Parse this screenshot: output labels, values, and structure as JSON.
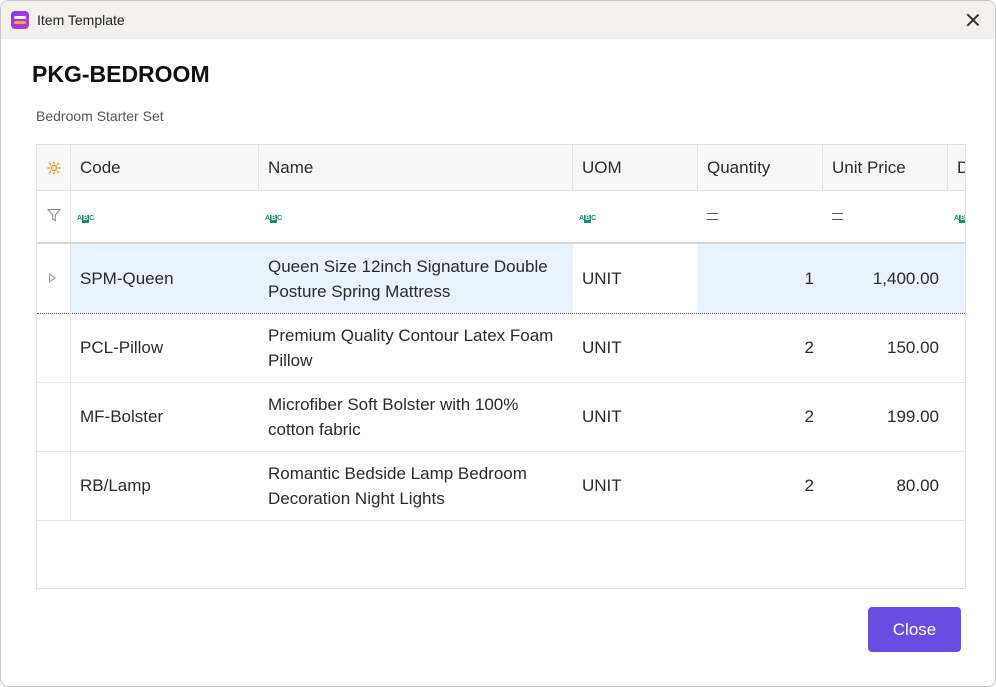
{
  "window": {
    "title": "Item Template"
  },
  "heading": "PKG-BEDROOM",
  "subheading": "Bedroom Starter Set",
  "grid": {
    "columns": [
      {
        "key": "code",
        "label": "Code",
        "filter": "text"
      },
      {
        "key": "name",
        "label": "Name",
        "filter": "text"
      },
      {
        "key": "uom",
        "label": "UOM",
        "filter": "text"
      },
      {
        "key": "quantity",
        "label": "Quantity",
        "filter": "equals"
      },
      {
        "key": "unit_price",
        "label": "Unit Price",
        "filter": "equals"
      },
      {
        "key": "d",
        "label": "D",
        "filter": "text"
      }
    ],
    "rows": [
      {
        "code": "SPM-Queen",
        "name": "Queen Size 12inch Signature Double Posture Spring Mattress",
        "uom": "UNIT",
        "quantity": "1",
        "unit_price": "1,400.00",
        "selected": true
      },
      {
        "code": "PCL-Pillow",
        "name": "Premium Quality Contour Latex Foam Pillow",
        "uom": "UNIT",
        "quantity": "2",
        "unit_price": "150.00"
      },
      {
        "code": "MF-Bolster",
        "name": "Microfiber Soft Bolster with 100% cotton fabric",
        "uom": "UNIT",
        "quantity": "2",
        "unit_price": "199.00"
      },
      {
        "code": "RB/Lamp",
        "name": "Romantic Bedside Lamp Bedroom Decoration Night Lights",
        "uom": "UNIT",
        "quantity": "2",
        "unit_price": "80.00"
      }
    ]
  },
  "footer": {
    "close_label": "Close"
  },
  "colors": {
    "accent": "#6b4be2",
    "selection": "#e8f3fd",
    "filter_icon": "#1a8a72",
    "settings_icon": "#f08a1a"
  },
  "icons": {
    "settings": "gear-icon",
    "filter": "filter-icon",
    "text_filter": "abc-filter-icon",
    "equals_filter": "equals-filter-icon",
    "row_indicator": "caret-right-icon"
  }
}
